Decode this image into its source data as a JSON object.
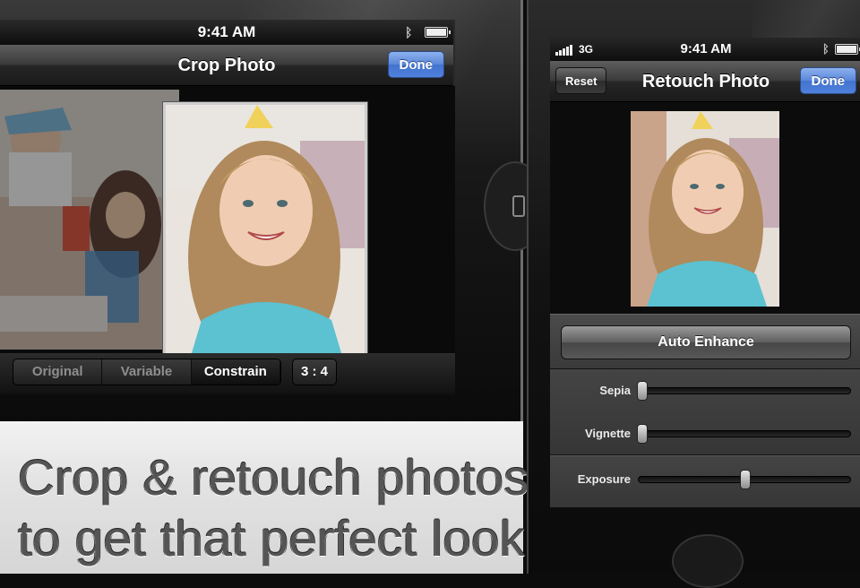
{
  "left": {
    "status": {
      "time": "9:41 AM"
    },
    "navbar": {
      "title": "Crop Photo",
      "done_label": "Done"
    },
    "segments": [
      {
        "label": "Original",
        "selected": false
      },
      {
        "label": "Variable",
        "selected": false
      },
      {
        "label": "Constrain",
        "selected": true
      }
    ],
    "ratio_label": "3 : 4"
  },
  "banner": {
    "line1": "Crop & retouch photos",
    "line2": "to get that perfect look"
  },
  "right": {
    "status": {
      "carrier": "3G",
      "time": "9:41 AM"
    },
    "navbar": {
      "title": "Retouch Photo",
      "reset_label": "Reset",
      "done_label": "Done"
    },
    "enhance_label": "Auto Enhance",
    "sliders": [
      {
        "label": "Sepia",
        "value": 0.0
      },
      {
        "label": "Vignette",
        "value": 0.0
      },
      {
        "label": "Exposure",
        "value": 0.5
      }
    ]
  },
  "icons": [
    "bluetooth-icon",
    "battery-icon",
    "signal-icon",
    "home-button-icon"
  ],
  "colors": {
    "done_blue": "#5a86d8",
    "banner_text": "#555555"
  }
}
